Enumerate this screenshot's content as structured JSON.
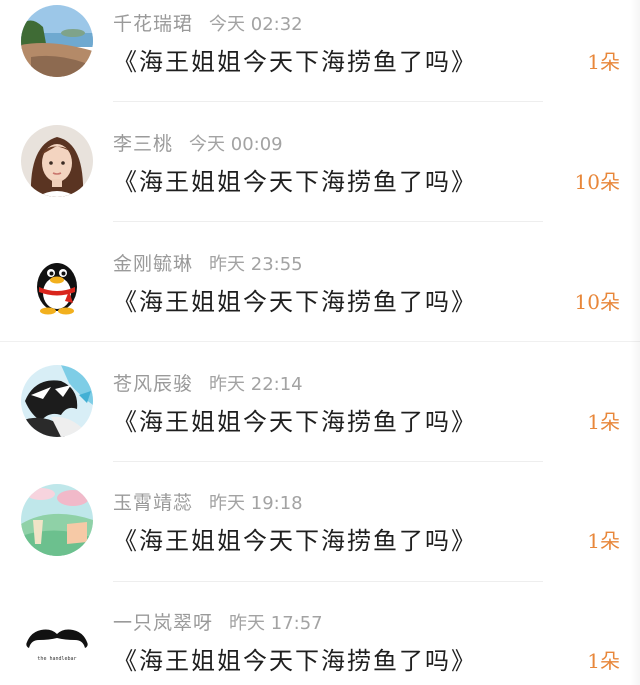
{
  "items": [
    {
      "name": "千花瑞珺",
      "time": "今天 02:32",
      "title": "《海王姐姐今天下海捞鱼了吗》",
      "amount": "1朵",
      "avatar": "scenic-coast-avatar"
    },
    {
      "name": "李三桃",
      "time": "今天 00:09",
      "title": "《海王姐姐今天下海捞鱼了吗》",
      "amount": "10朵",
      "avatar": "woman-portrait-avatar"
    },
    {
      "name": "金刚毓琳",
      "time": "昨天 23:55",
      "title": "《海王姐姐今天下海捞鱼了吗》",
      "amount": "10朵",
      "avatar": "penguin-avatar"
    },
    {
      "name": "苍风辰骏",
      "time": "昨天 22:14",
      "title": "《海王姐姐今天下海捞鱼了吗》",
      "amount": "1朵",
      "avatar": "anime-character-avatar"
    },
    {
      "name": "玉霄靖蕊",
      "time": "昨天 19:18",
      "title": "《海王姐姐今天下海捞鱼了吗》",
      "amount": "1朵",
      "avatar": "landscape-illustration-avatar"
    },
    {
      "name": "一只岚翠呀",
      "time": "昨天 17:57",
      "title": "《海王姐姐今天下海捞鱼了吗》",
      "amount": "1朵",
      "avatar": "mustache-logo-avatar",
      "avatar_caption": "the handlebar"
    }
  ],
  "colors": {
    "amount": "#e8873a",
    "meta": "#9a9a9a",
    "title": "#1f1f1f"
  }
}
